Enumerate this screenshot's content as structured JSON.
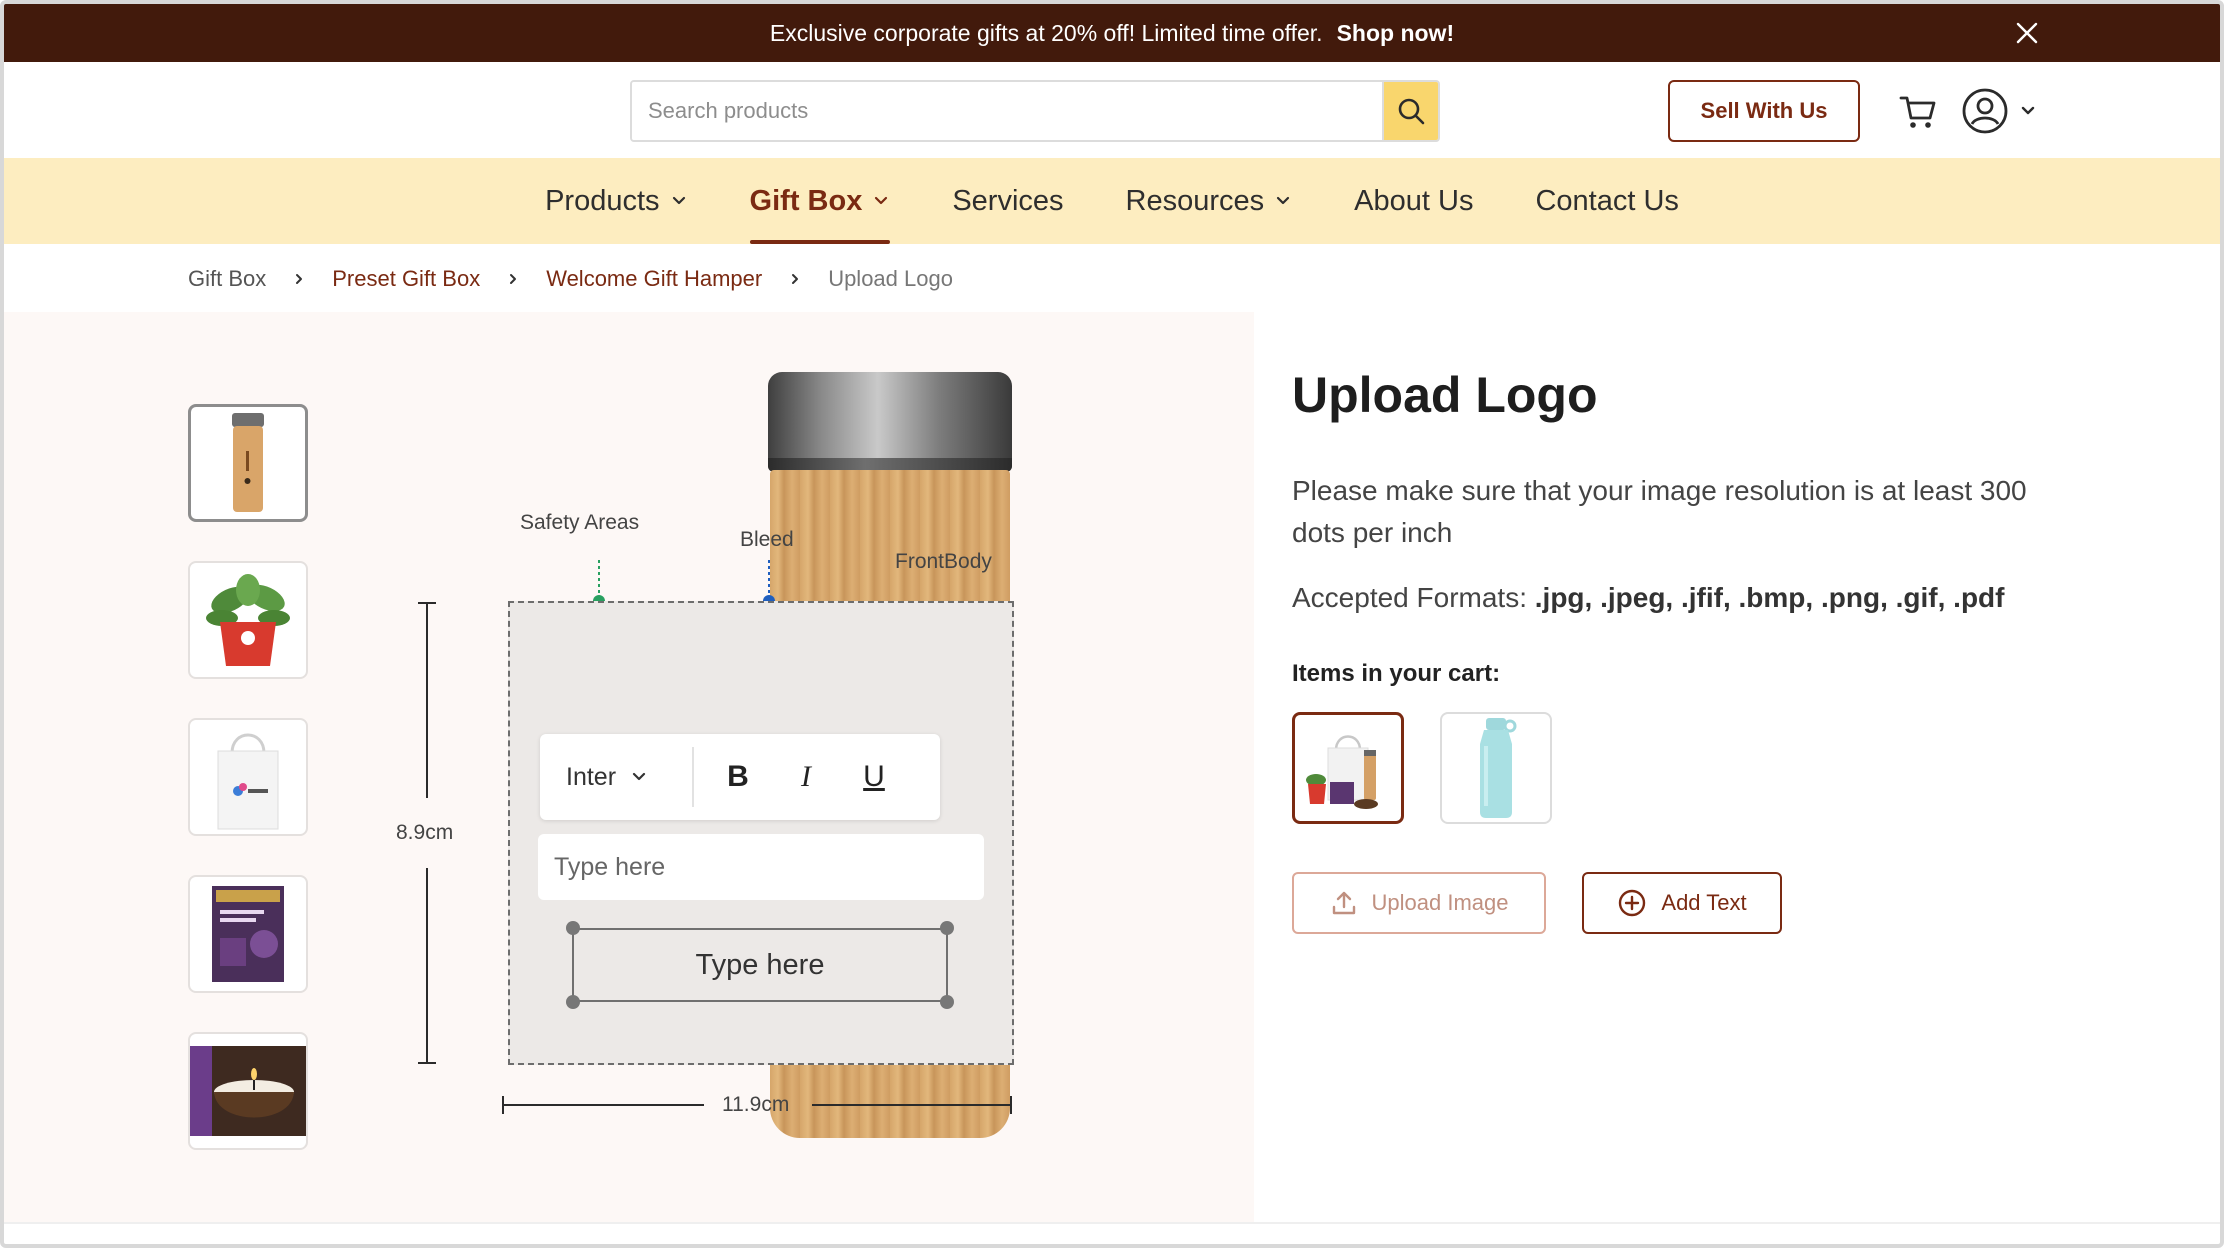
{
  "promo": {
    "text": "Exclusive corporate gifts at 20% off! Limited time offer.",
    "cta": "Shop now!"
  },
  "header": {
    "search_placeholder": "Search products",
    "sell_label": "Sell With Us"
  },
  "nav": [
    {
      "label": "Products",
      "has_dropdown": true,
      "active": false
    },
    {
      "label": "Gift Box",
      "has_dropdown": true,
      "active": true
    },
    {
      "label": "Services",
      "has_dropdown": false,
      "active": false
    },
    {
      "label": "Resources",
      "has_dropdown": true,
      "active": false
    },
    {
      "label": "About Us",
      "has_dropdown": false,
      "active": false
    },
    {
      "label": "Contact Us",
      "has_dropdown": false,
      "active": false
    }
  ],
  "breadcrumb": [
    "Gift Box",
    "Preset Gift Box",
    "Welcome Gift Hamper",
    "Upload Logo"
  ],
  "editor": {
    "safety_label": "Safety Areas",
    "bleed_label": "Bleed",
    "front_label": "FrontBody",
    "height_dim": "8.9cm",
    "width_dim": "11.9cm",
    "font_name": "Inter",
    "bold": "B",
    "italic": "I",
    "underline": "U",
    "input_placeholder": "Type here",
    "text_box": "Type here"
  },
  "panel": {
    "title": "Upload Logo",
    "description": "Please make sure that your image resolution is at least 300 dots per inch",
    "formats_label": "Accepted Formats:",
    "formats_value": ".jpg, .jpeg, .jfif, .bmp, .png, .gif, .pdf",
    "cart_label": "Items in your cart:",
    "upload_label": "Upload Image",
    "add_text_label": "Add Text"
  },
  "colors": {
    "brand": "#7a2a12",
    "banner": "#421a0c",
    "nav_bg": "#fdedc0",
    "search_btn": "#f9d66d",
    "stage_bg": "#fdf8f6"
  }
}
